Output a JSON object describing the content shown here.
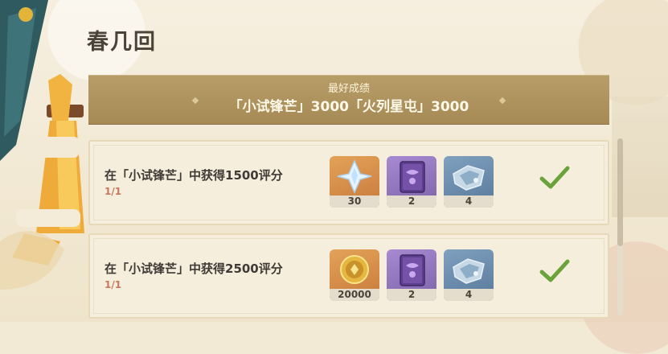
{
  "page": {
    "title": "春几回"
  },
  "best": {
    "heading": "最好成绩",
    "scores": "「小试锋芒」3000「火列星屯」3000"
  },
  "tasks": [
    {
      "title": "在「小试锋芒」中获得1500评分",
      "progress": "1/1",
      "completed": true,
      "rewards": [
        {
          "icon": "primogem-icon",
          "count": "30"
        },
        {
          "icon": "heros-wit-book-icon",
          "count": "2"
        },
        {
          "icon": "mystic-enhancement-ore-icon",
          "count": "4"
        }
      ]
    },
    {
      "title": "在「小试锋芒」中获得2500评分",
      "progress": "1/1",
      "completed": true,
      "rewards": [
        {
          "icon": "mora-coin-icon",
          "count": "20000"
        },
        {
          "icon": "heros-wit-book-icon",
          "count": "2"
        },
        {
          "icon": "mystic-enhancement-ore-icon",
          "count": "4"
        }
      ]
    }
  ],
  "colors": {
    "check": "#6aa33a",
    "progress": "#c9775c",
    "banner": "#a68a56"
  },
  "scroll": {
    "position": 0
  }
}
